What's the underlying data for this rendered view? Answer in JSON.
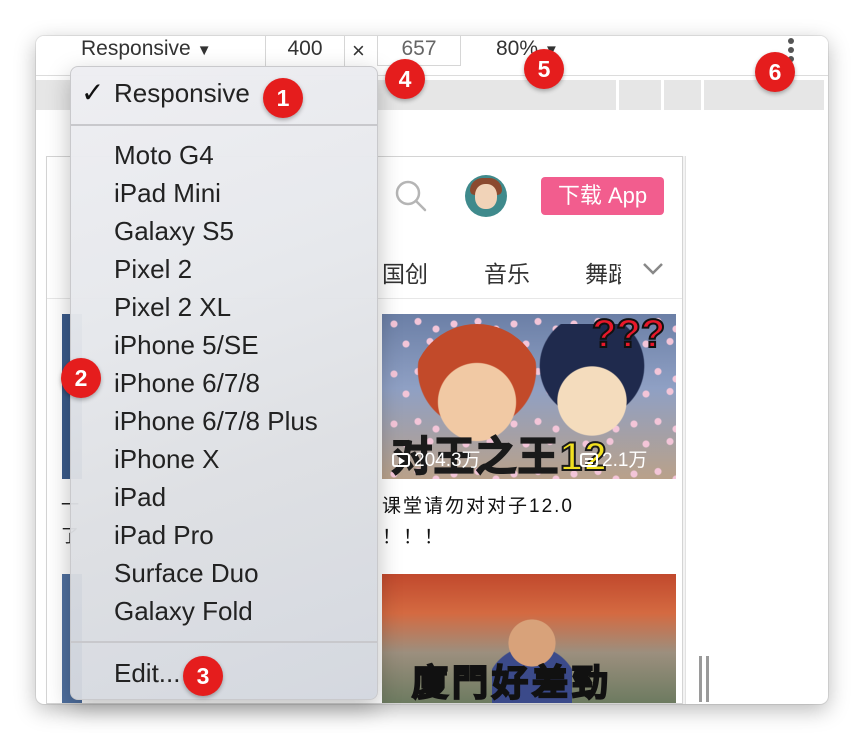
{
  "toolbar": {
    "device_label": "Responsive",
    "width_value": "400",
    "times_symbol": "×",
    "height_value": "657",
    "zoom_label": "80%"
  },
  "menu": {
    "selected": "Responsive",
    "devices": [
      "Moto G4",
      "iPad Mini",
      "Galaxy S5",
      "Pixel 2",
      "Pixel 2 XL",
      "iPhone 5/SE",
      "iPhone 6/7/8",
      "iPhone 6/7/8 Plus",
      "iPhone X",
      "iPad",
      "iPad Pro",
      "Surface Duo",
      "Galaxy Fold"
    ],
    "edit_label": "Edit..."
  },
  "page": {
    "download_button": "下载 App",
    "tabs": [
      "国创",
      "音乐",
      "舞蹈"
    ],
    "card1": {
      "overlay_text": "对王之王12",
      "overlay_qmarks": "???",
      "views": "204.3万",
      "danmaku": "2.1万",
      "title_line1": "课堂请勿对对子12.0",
      "title_line2": "！！！"
    },
    "card2": {
      "overlay_text": "廈門好差勁"
    },
    "left_fragments": [
      "一",
      "了"
    ]
  },
  "badges": [
    "1",
    "2",
    "3",
    "4",
    "5",
    "6"
  ],
  "colors": {
    "badge_red": "#e51d1d",
    "bilibili_pink": "#f25d8e"
  }
}
